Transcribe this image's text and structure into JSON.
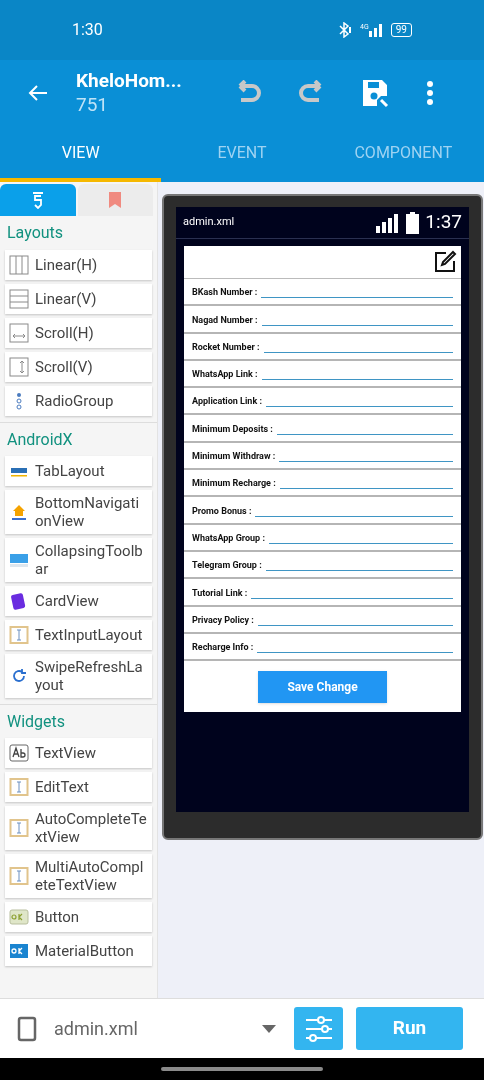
{
  "status_bar": {
    "time": "1:30",
    "battery": "99",
    "network": "4G"
  },
  "app_bar": {
    "title": "KheloHom...",
    "subtitle": "751"
  },
  "tabs": [
    {
      "label": "VIEW",
      "selected": true
    },
    {
      "label": "EVENT",
      "selected": false
    },
    {
      "label": "COMPONENT",
      "selected": false
    }
  ],
  "palette_tabs": [
    {
      "selected": true
    },
    {
      "selected": false
    }
  ],
  "palette": [
    {
      "kind": "section",
      "label": "Layouts"
    },
    {
      "kind": "widget",
      "label": "Linear(H)"
    },
    {
      "kind": "widget",
      "label": "Linear(V)"
    },
    {
      "kind": "widget",
      "label": "Scroll(H)"
    },
    {
      "kind": "widget",
      "label": "Scroll(V)"
    },
    {
      "kind": "widget",
      "label": "RadioGroup"
    },
    {
      "kind": "section",
      "label": "AndroidX"
    },
    {
      "kind": "widget",
      "label": "TabLayout"
    },
    {
      "kind": "widget",
      "label": "BottomNavigationView"
    },
    {
      "kind": "widget",
      "label": "CollapsingToolbar"
    },
    {
      "kind": "widget",
      "label": "CardView"
    },
    {
      "kind": "widget",
      "label": "TextInputLayout"
    },
    {
      "kind": "widget",
      "label": "SwipeRefreshLayout"
    },
    {
      "kind": "section",
      "label": "Widgets"
    },
    {
      "kind": "widget",
      "label": "TextView"
    },
    {
      "kind": "widget",
      "label": "EditText"
    },
    {
      "kind": "widget",
      "label": "AutoCompleteTextView"
    },
    {
      "kind": "widget",
      "label": "MultiAutoCompleteTextView"
    },
    {
      "kind": "widget",
      "label": "Button"
    },
    {
      "kind": "widget",
      "label": "MaterialButton"
    }
  ],
  "preview": {
    "file": "admin.xml",
    "time": "1:37",
    "fields": [
      "BKash Number :",
      "Nagad Number :",
      "Rocket Number :",
      "WhatsApp Link :",
      "Application Link :",
      "Minimum Deposits :",
      "Minimum Withdraw :",
      "Minimum Recharge :",
      "Promo Bonus :",
      "WhatsApp Group :",
      "Telegram Group :",
      "Tutorial Link :",
      "Privacy Policy :",
      "Recharge Info :"
    ],
    "button": "Save Change"
  },
  "bottom_bar": {
    "file": "admin.xml",
    "run": "Run"
  }
}
